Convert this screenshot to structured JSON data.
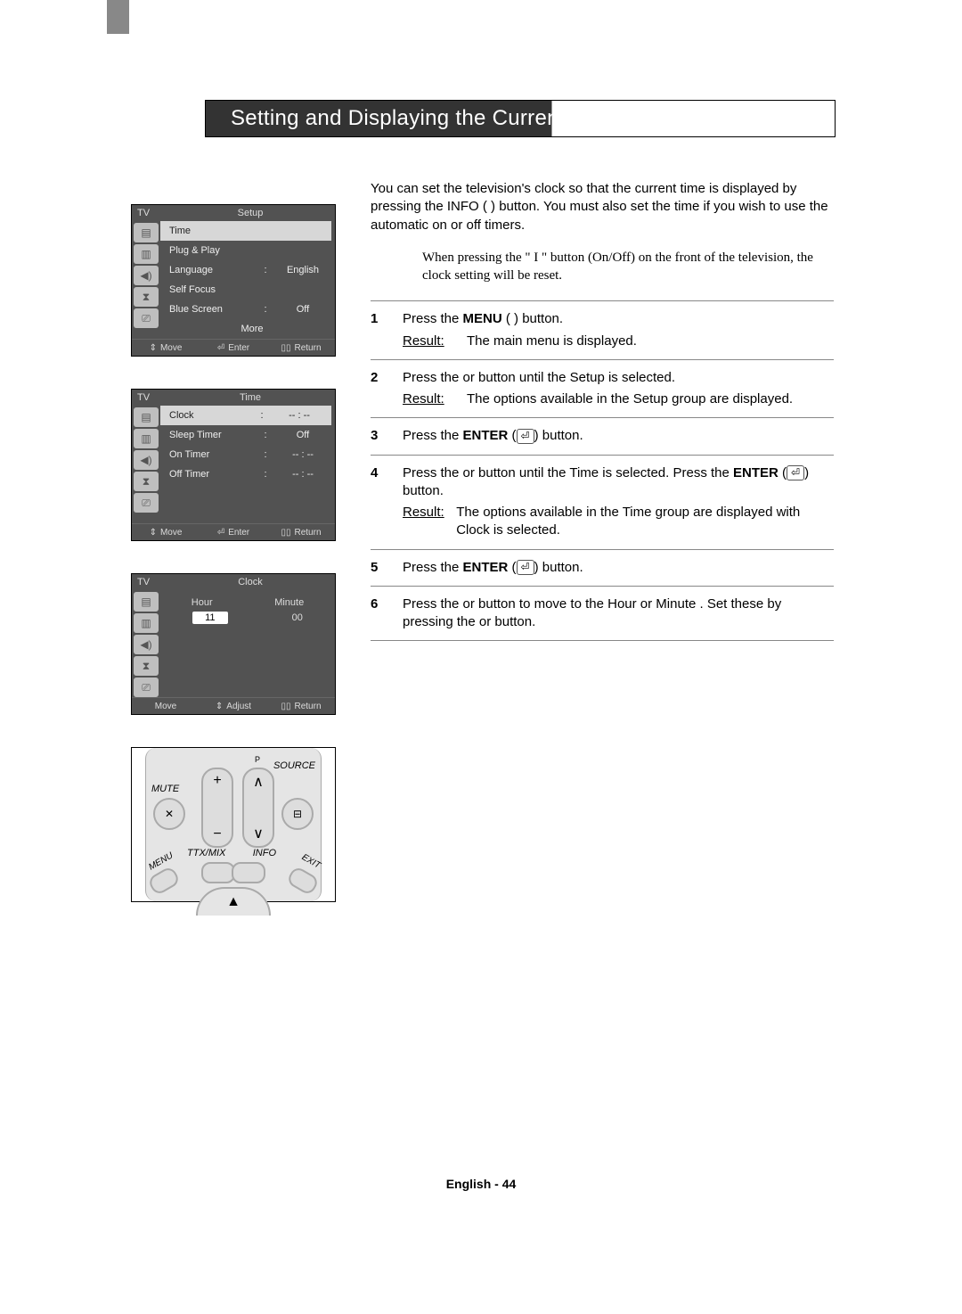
{
  "title": "Setting and Displaying the Current Time",
  "intro": "You can set the television's clock so that the current time is displayed by pressing the INFO (       ) button. You must also set the time if you wish to use the automatic on or off timers.",
  "note": "When pressing the \" I \" button (On/Off) on the front of the television, the clock setting will be reset.",
  "pageNum": "English - 44",
  "osd1": {
    "tv": "TV",
    "title": "Setup",
    "rows": [
      {
        "label": "Time",
        "sel": true
      },
      {
        "label": "Plug & Play"
      },
      {
        "label": "Language",
        "sep": ":",
        "val": "English"
      },
      {
        "label": "Self Focus"
      },
      {
        "label": "Blue Screen",
        "sep": ":",
        "val": "Off"
      },
      {
        "label": "More",
        "center": true
      }
    ],
    "footer": {
      "a": "Move",
      "b": "Enter",
      "c": "Return"
    }
  },
  "osd2": {
    "tv": "TV",
    "title": "Time",
    "rows": [
      {
        "label": "Clock",
        "sep": ":",
        "val": "-- : --",
        "sel": true
      },
      {
        "label": "Sleep Timer",
        "sep": ":",
        "val": "Off"
      },
      {
        "label": "On Timer",
        "sep": ":",
        "val": "-- : --"
      },
      {
        "label": "Off Timer",
        "sep": ":",
        "val": "-- : --"
      },
      {
        "label": ""
      },
      {
        "label": ""
      }
    ],
    "footer": {
      "a": "Move",
      "b": "Enter",
      "c": "Return"
    }
  },
  "osd3": {
    "tv": "TV",
    "title": "Clock",
    "hour_lbl": "Hour",
    "minute_lbl": "Minute",
    "hour": "11",
    "minute": "00",
    "footer": {
      "a": "Move",
      "b": "Adjust",
      "c": "Return"
    }
  },
  "remote": {
    "mute": "MUTE",
    "p": "P",
    "source": "SOURCE",
    "ttx": "TTX/MIX",
    "info": "INFO",
    "menu": "MENU",
    "exit": "EXIT"
  },
  "steps": {
    "s1a": "Press the ",
    "s1b": "MENU",
    "s1c": " (        ) button.",
    "s1r": "The main menu is displayed.",
    "s2a": "Press the     or     button until the Setup  is selected.",
    "s2r": "The options available in the Setup  group are displayed.",
    "s3": "Press the ",
    "s3b": "ENTER",
    "s3c": " (       ) button.",
    "s4a": "Press the     or     button until the Time  is selected. Press the ",
    "s4b": "ENTER",
    "s4c": " (       ) button.",
    "s4r": "The options available in the Time  group are displayed with Clock  is selected.",
    "s5": "Press the ",
    "s5b": "ENTER",
    "s5c": " (       ) button.",
    "s6": "Press the     or     button to move to the Hour  or Minute  . Set these by pressing the     or     button.",
    "result": "Result:"
  }
}
